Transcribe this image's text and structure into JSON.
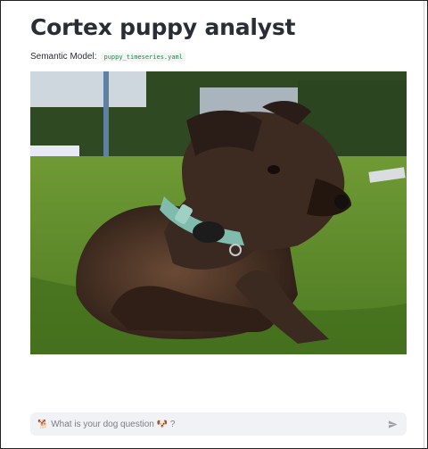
{
  "app": {
    "title": "Cortex puppy analyst"
  },
  "semantic_model": {
    "label": "Semantic Model:",
    "file": "puppy_timeseries.yaml"
  },
  "photo": {
    "subject": "brindle-puppy-photo"
  },
  "chat": {
    "placeholder": "🐕 What is your dog question 🐶 ?",
    "send_icon": "send-icon"
  },
  "colors": {
    "code_text": "#1c8a4a",
    "input_bg": "#f0f2f6",
    "title_text": "#2a2d35"
  }
}
